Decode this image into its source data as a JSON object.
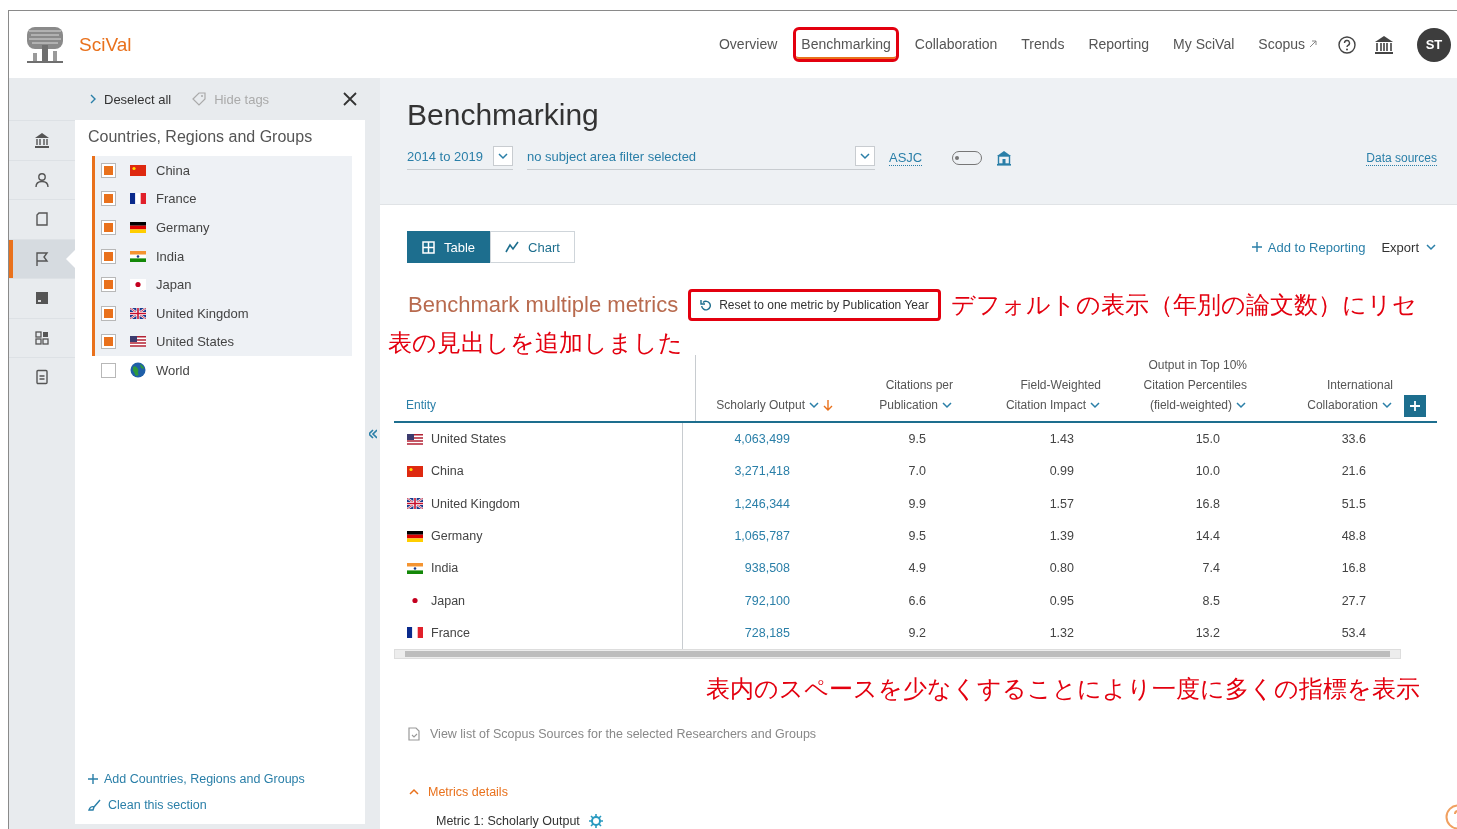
{
  "app": {
    "name": "SciVal"
  },
  "nav": [
    {
      "label": "Overview",
      "selected": false,
      "highlighted": false,
      "external": false
    },
    {
      "label": "Benchmarking",
      "selected": true,
      "highlighted": true,
      "external": false
    },
    {
      "label": "Collaboration",
      "selected": false,
      "highlighted": false,
      "external": false
    },
    {
      "label": "Trends",
      "selected": false,
      "highlighted": false,
      "external": false
    },
    {
      "label": "Reporting",
      "selected": false,
      "highlighted": false,
      "external": false
    },
    {
      "label": "My SciVal",
      "selected": false,
      "highlighted": false,
      "external": false
    },
    {
      "label": "Scopus",
      "selected": false,
      "highlighted": false,
      "external": true
    }
  ],
  "user": {
    "initials": "ST"
  },
  "rail": [
    {
      "kind": "institution",
      "selected": false
    },
    {
      "kind": "person",
      "selected": false
    },
    {
      "kind": "document",
      "selected": false
    },
    {
      "kind": "flag",
      "selected": true
    },
    {
      "kind": "journal",
      "selected": false
    },
    {
      "kind": "grid",
      "selected": false
    },
    {
      "kind": "report",
      "selected": false
    }
  ],
  "sidebar": {
    "deselect": "Deselect all",
    "hide_tags": "Hide tags",
    "title": "Countries, Regions and Groups",
    "items": [
      {
        "name": "China",
        "kind": "cn",
        "checked": true
      },
      {
        "name": "France",
        "kind": "fr",
        "checked": true
      },
      {
        "name": "Germany",
        "kind": "de",
        "checked": true
      },
      {
        "name": "India",
        "kind": "in",
        "checked": true
      },
      {
        "name": "Japan",
        "kind": "jp",
        "checked": true
      },
      {
        "name": "United Kingdom",
        "kind": "gb",
        "checked": true
      },
      {
        "name": "United States",
        "kind": "us",
        "checked": true
      },
      {
        "name": "World",
        "kind": "world",
        "checked": false
      }
    ],
    "add": "Add Countries, Regions and Groups",
    "clean": "Clean this section"
  },
  "page": {
    "title": "Benchmarking",
    "years": "2014 to 2019",
    "subject": "no subject area filter selected",
    "asjc": "ASJC",
    "toggle_on": false,
    "data_sources": "Data sources"
  },
  "views": [
    {
      "label": "Table",
      "kind": "table",
      "selected": true
    },
    {
      "label": "Chart",
      "kind": "chart",
      "selected": false
    }
  ],
  "actions": {
    "add_reporting": "Add to Reporting",
    "export": "Export"
  },
  "section": {
    "title": "Benchmark multiple metrics",
    "reset": "Reset to one metric by Publication Year",
    "reset_highlighted": true
  },
  "annotations": [
    "デフォルトの表示（年別の論文数）にリセ",
    "表の見出しを追加しました",
    "表内のスペースを少なくすることにより一度に多くの指標を表示"
  ],
  "table": {
    "columns": [
      {
        "lines": [
          "Entity"
        ],
        "menu": false,
        "sorted": false
      },
      {
        "lines": [
          "Scholarly Output"
        ],
        "menu": true,
        "sorted": true
      },
      {
        "lines": [
          "Citations per",
          "Publication"
        ],
        "menu": true,
        "sorted": false
      },
      {
        "lines": [
          "Field-Weighted",
          "Citation Impact"
        ],
        "menu": true,
        "sorted": false
      },
      {
        "lines": [
          "Output in Top 10%",
          "Citation Percentiles",
          "(field-weighted)"
        ],
        "menu": true,
        "sorted": false
      },
      {
        "lines": [
          "International",
          "Collaboration"
        ],
        "menu": true,
        "sorted": false
      }
    ],
    "rows": [
      {
        "entity": "United States",
        "kind": "us",
        "values": [
          "4,063,499",
          "9.5",
          "1.43",
          "15.0",
          "33.6"
        ]
      },
      {
        "entity": "China",
        "kind": "cn",
        "values": [
          "3,271,418",
          "7.0",
          "0.99",
          "10.0",
          "21.6"
        ]
      },
      {
        "entity": "United Kingdom",
        "kind": "gb",
        "values": [
          "1,246,344",
          "9.9",
          "1.57",
          "16.8",
          "51.5"
        ]
      },
      {
        "entity": "Germany",
        "kind": "de",
        "values": [
          "1,065,787",
          "9.5",
          "1.39",
          "14.4",
          "48.8"
        ]
      },
      {
        "entity": "India",
        "kind": "in",
        "values": [
          "938,508",
          "4.9",
          "0.80",
          "7.4",
          "16.8"
        ]
      },
      {
        "entity": "Japan",
        "kind": "jp",
        "values": [
          "792,100",
          "6.6",
          "0.95",
          "8.5",
          "27.7"
        ]
      },
      {
        "entity": "France",
        "kind": "fr",
        "values": [
          "728,185",
          "9.2",
          "1.32",
          "13.2",
          "53.4"
        ]
      }
    ]
  },
  "sources_link": "View list of Scopus Sources for the selected Researchers and Groups",
  "metrics": {
    "title": "Metrics details",
    "expanded": true,
    "items": [
      "Metric 1:  Scholarly Output"
    ]
  }
}
